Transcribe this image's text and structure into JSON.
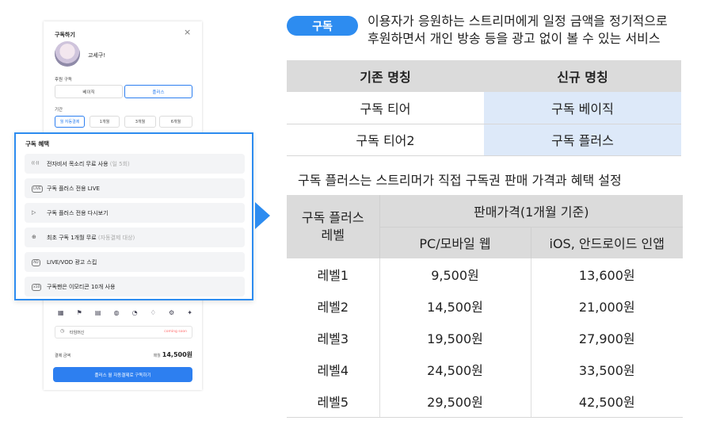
{
  "modal": {
    "title": "구독하기",
    "close": "×",
    "streamer_name": "고세구!",
    "plan_label": "후원 구독",
    "plans": [
      "베이직",
      "플러스"
    ],
    "period_label": "기간",
    "periods": [
      "월 자동결제",
      "1개월",
      "3개월",
      "6개월"
    ],
    "benefits_title": "구독 혜택",
    "benefits": [
      {
        "icon": "voice-icon",
        "glyph": "((·))",
        "text": "전자비서 목소리 무료 사용",
        "note": " (일 5회)"
      },
      {
        "icon": "live-icon",
        "glyph": "LIVE",
        "text": "구독 플러스 전용 LIVE",
        "note": ""
      },
      {
        "icon": "replay-icon",
        "glyph": "▷",
        "text": "구독 플러스 전용 다시보기",
        "note": ""
      },
      {
        "icon": "gift-icon",
        "glyph": "⊕",
        "text": "최초 구독 1개월 무료",
        "note": " (자동결제 대상)"
      },
      {
        "icon": "ad-icon",
        "glyph": "AD",
        "text": "LIVE/VOD 광고 스킵",
        "note": ""
      },
      {
        "icon": "emoticon-icon",
        "glyph": "x10",
        "text": "구독팬은 이모티콘 10개 사용",
        "note": ""
      }
    ],
    "time_machine": "타임머신",
    "coming_soon": "coming soon",
    "pay_label": "결제 금액",
    "pay_unit": "매월",
    "pay_amount": "14,500원",
    "subscribe_button": "플러스 월 자동결제로 구독하기"
  },
  "info": {
    "pill": "구독",
    "desc_line1": "이용자가 응원하는 스트리머에게 일정 금액을 정기적으로",
    "desc_line2": "후원하면서 개인 방송 등을 광고 없이 볼 수 있는 서비스"
  },
  "naming_table": {
    "headers": [
      "기존 명칭",
      "신규 명칭"
    ],
    "rows": [
      [
        "구독 티어",
        "구독 베이직"
      ],
      [
        "구독 티어2",
        "구독 플러스"
      ]
    ]
  },
  "pricing": {
    "subtitle": "구독 플러스는 스트리머가 직접 구독권 판매 가격과 혜택 설정",
    "level_header_1": "구독 플러스",
    "level_header_2": "레벨",
    "price_header": "판매가격(1개월 기준)",
    "sub_headers": [
      "PC/모바일 웹",
      "iOS, 안드로이드 인앱"
    ],
    "rows": [
      [
        "레벨1",
        "9,500원",
        "13,600원"
      ],
      [
        "레벨2",
        "14,500원",
        "21,000원"
      ],
      [
        "레벨3",
        "19,500원",
        "27,900원"
      ],
      [
        "레벨4",
        "24,500원",
        "33,500원"
      ],
      [
        "레벨5",
        "29,500원",
        "42,500원"
      ]
    ]
  },
  "colors": {
    "accent": "#2d8cf0",
    "header_gray": "#dbdbdb",
    "highlight_blue": "#dde9f9"
  }
}
